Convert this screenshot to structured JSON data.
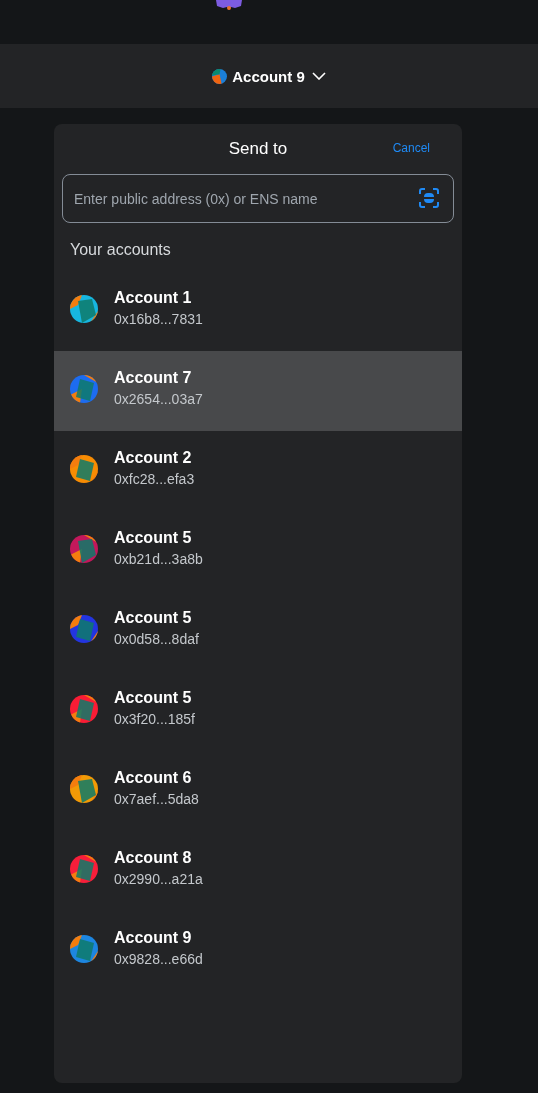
{
  "account_menu": {
    "name": "Account 9",
    "color": "#1b7fd8"
  },
  "send_panel": {
    "title": "Send to",
    "cancel": "Cancel",
    "search": {
      "placeholder": "Enter public address (0x) or ENS name"
    },
    "section_title": "Your accounts",
    "accounts": [
      {
        "name": "Account 1",
        "address": "0x16b8...7831",
        "selected": false,
        "color": "#17b6e0"
      },
      {
        "name": "Account 7",
        "address": "0x2654...03a7",
        "selected": true,
        "color": "#1d6cf0"
      },
      {
        "name": "Account 2",
        "address": "0xfc28...efa3",
        "selected": false,
        "color": "#f78c03"
      },
      {
        "name": "Account 5",
        "address": "0xb21d...3a8b",
        "selected": false,
        "color": "#c2185b"
      },
      {
        "name": "Account 5",
        "address": "0x0d58...8daf",
        "selected": false,
        "color": "#2335e0"
      },
      {
        "name": "Account 5",
        "address": "0x3f20...185f",
        "selected": false,
        "color": "#f91c35"
      },
      {
        "name": "Account 6",
        "address": "0x7aef...5da8",
        "selected": false,
        "color": "#f29a06"
      },
      {
        "name": "Account 8",
        "address": "0x2990...a21a",
        "selected": false,
        "color": "#f71e3a"
      },
      {
        "name": "Account 9",
        "address": "0x9828...e66d",
        "selected": false,
        "color": "#1d86e0"
      }
    ]
  }
}
